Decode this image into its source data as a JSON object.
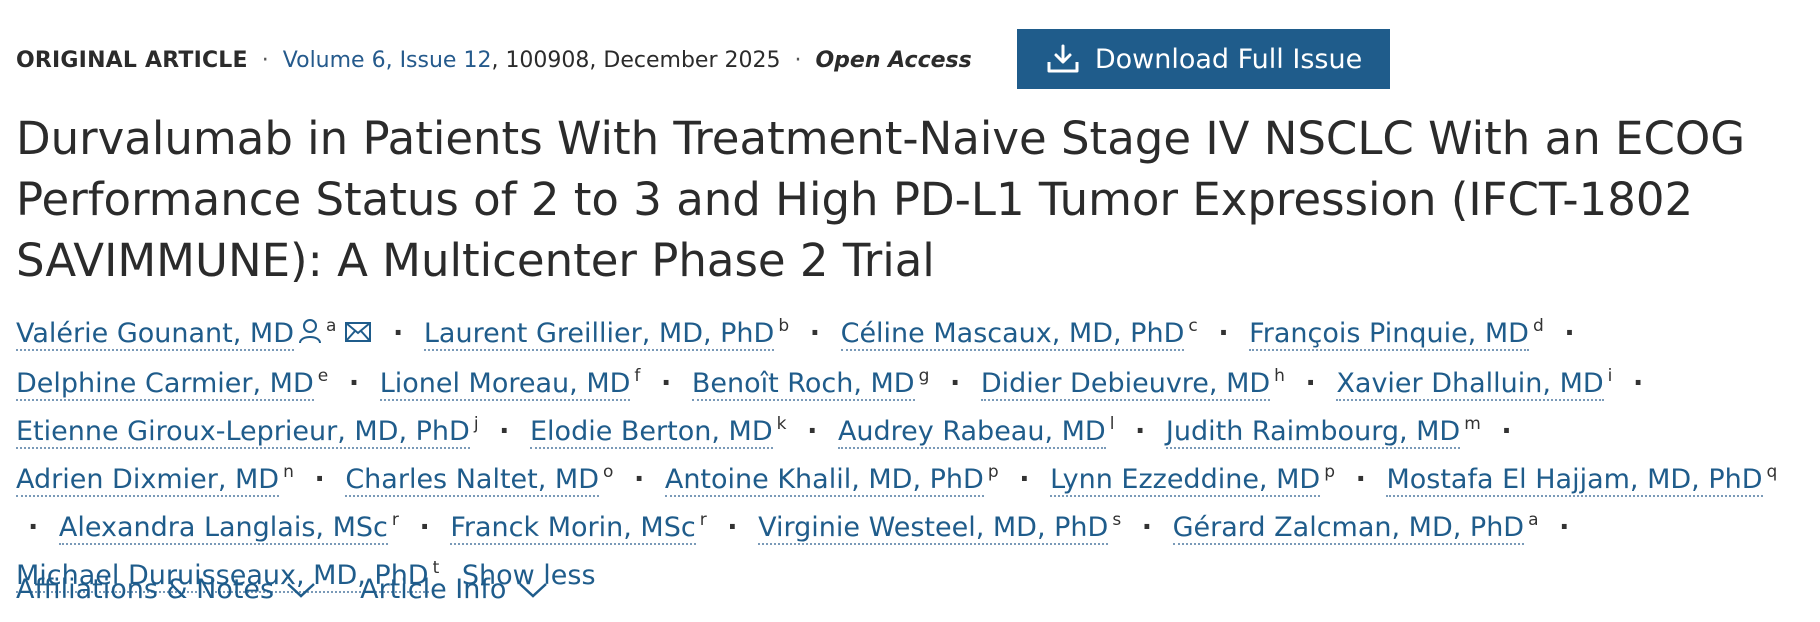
{
  "meta": {
    "type": "ORIGINAL ARTICLE",
    "separator": "·",
    "volume": "Volume 6, Issue 12",
    "issue_tail": ", 100908, December 2025",
    "open_access": "Open Access"
  },
  "download_button": {
    "label": "Download Full Issue",
    "icon": "download-icon"
  },
  "title": "Durvalumab in Patients With Treatment-Naive Stage IV NSCLC With an ECOG Performance Status of 2 to 3 and High PD-L1 Tumor Expression (IFCT-1802 SAVIMMUNE): A Multicenter Phase 2 Trial",
  "authors": [
    {
      "name": "Valérie Gounant, MD",
      "sup": "a",
      "icons": [
        "person-icon",
        "email-icon"
      ]
    },
    {
      "name": "Laurent Greillier, MD, PhD",
      "sup": "b"
    },
    {
      "name": "Céline Mascaux, MD, PhD",
      "sup": "c"
    },
    {
      "name": "François Pinquie, MD",
      "sup": "d"
    },
    {
      "name": "Delphine Carmier, MD",
      "sup": "e"
    },
    {
      "name": "Lionel Moreau, MD",
      "sup": "f"
    },
    {
      "name": "Benoît Roch, MD",
      "sup": "g"
    },
    {
      "name": "Didier Debieuvre, MD",
      "sup": "h"
    },
    {
      "name": "Xavier Dhalluin, MD",
      "sup": "i"
    },
    {
      "name": "Etienne Giroux-Leprieur, MD, PhD",
      "sup": "j"
    },
    {
      "name": "Elodie Berton, MD",
      "sup": "k"
    },
    {
      "name": "Audrey Rabeau, MD",
      "sup": "l"
    },
    {
      "name": "Judith Raimbourg, MD",
      "sup": "m"
    },
    {
      "name": "Adrien Dixmier, MD",
      "sup": "n"
    },
    {
      "name": "Charles Naltet, MD",
      "sup": "o"
    },
    {
      "name": "Antoine Khalil, MD, PhD",
      "sup": "p"
    },
    {
      "name": "Lynn Ezzeddine, MD",
      "sup": "p"
    },
    {
      "name": "Mostafa El Hajjam, MD, PhD",
      "sup": "q"
    },
    {
      "name": "Alexandra Langlais, MSc",
      "sup": "r"
    },
    {
      "name": "Franck Morin, MSc",
      "sup": "r"
    },
    {
      "name": "Virginie Westeel, MD, PhD",
      "sup": "s"
    },
    {
      "name": "Gérard Zalcman, MD, PhD",
      "sup": "a"
    },
    {
      "name": "Michael Duruisseaux, MD, PhD",
      "sup": "t"
    }
  ],
  "author_separator": "·",
  "show_less": "Show less",
  "toggles": {
    "affiliations": "Affiliations & Notes",
    "article_info": "Article Info"
  },
  "colors": {
    "link": "#1f5c8b",
    "button_bg": "#1f5c8b",
    "text": "#2b2b2b"
  }
}
